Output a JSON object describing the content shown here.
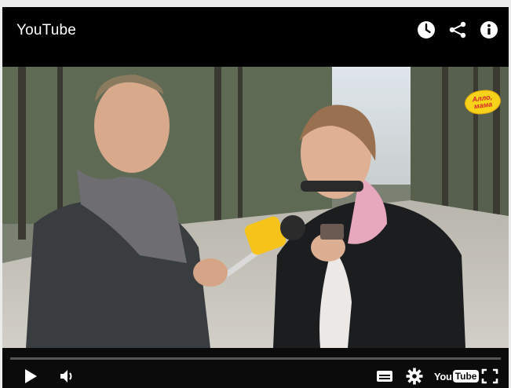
{
  "player": {
    "title": "YouTube",
    "top_icons": [
      "watch-later-icon",
      "share-icon",
      "info-icon"
    ],
    "watermark_text": "Алло, мама",
    "progress": 0.0,
    "controls": {
      "left": [
        "play-icon",
        "volume-icon"
      ],
      "right": [
        "captions-icon",
        "settings-icon",
        "youtube-logo",
        "fullscreen-icon"
      ]
    },
    "logo": {
      "you": "You",
      "tube": "Tube"
    }
  },
  "colors": {
    "bar_bg": "#000000",
    "accent_red": "#cc181e",
    "watermark_yellow": "#f7d21a",
    "watermark_text": "#d8262a"
  }
}
